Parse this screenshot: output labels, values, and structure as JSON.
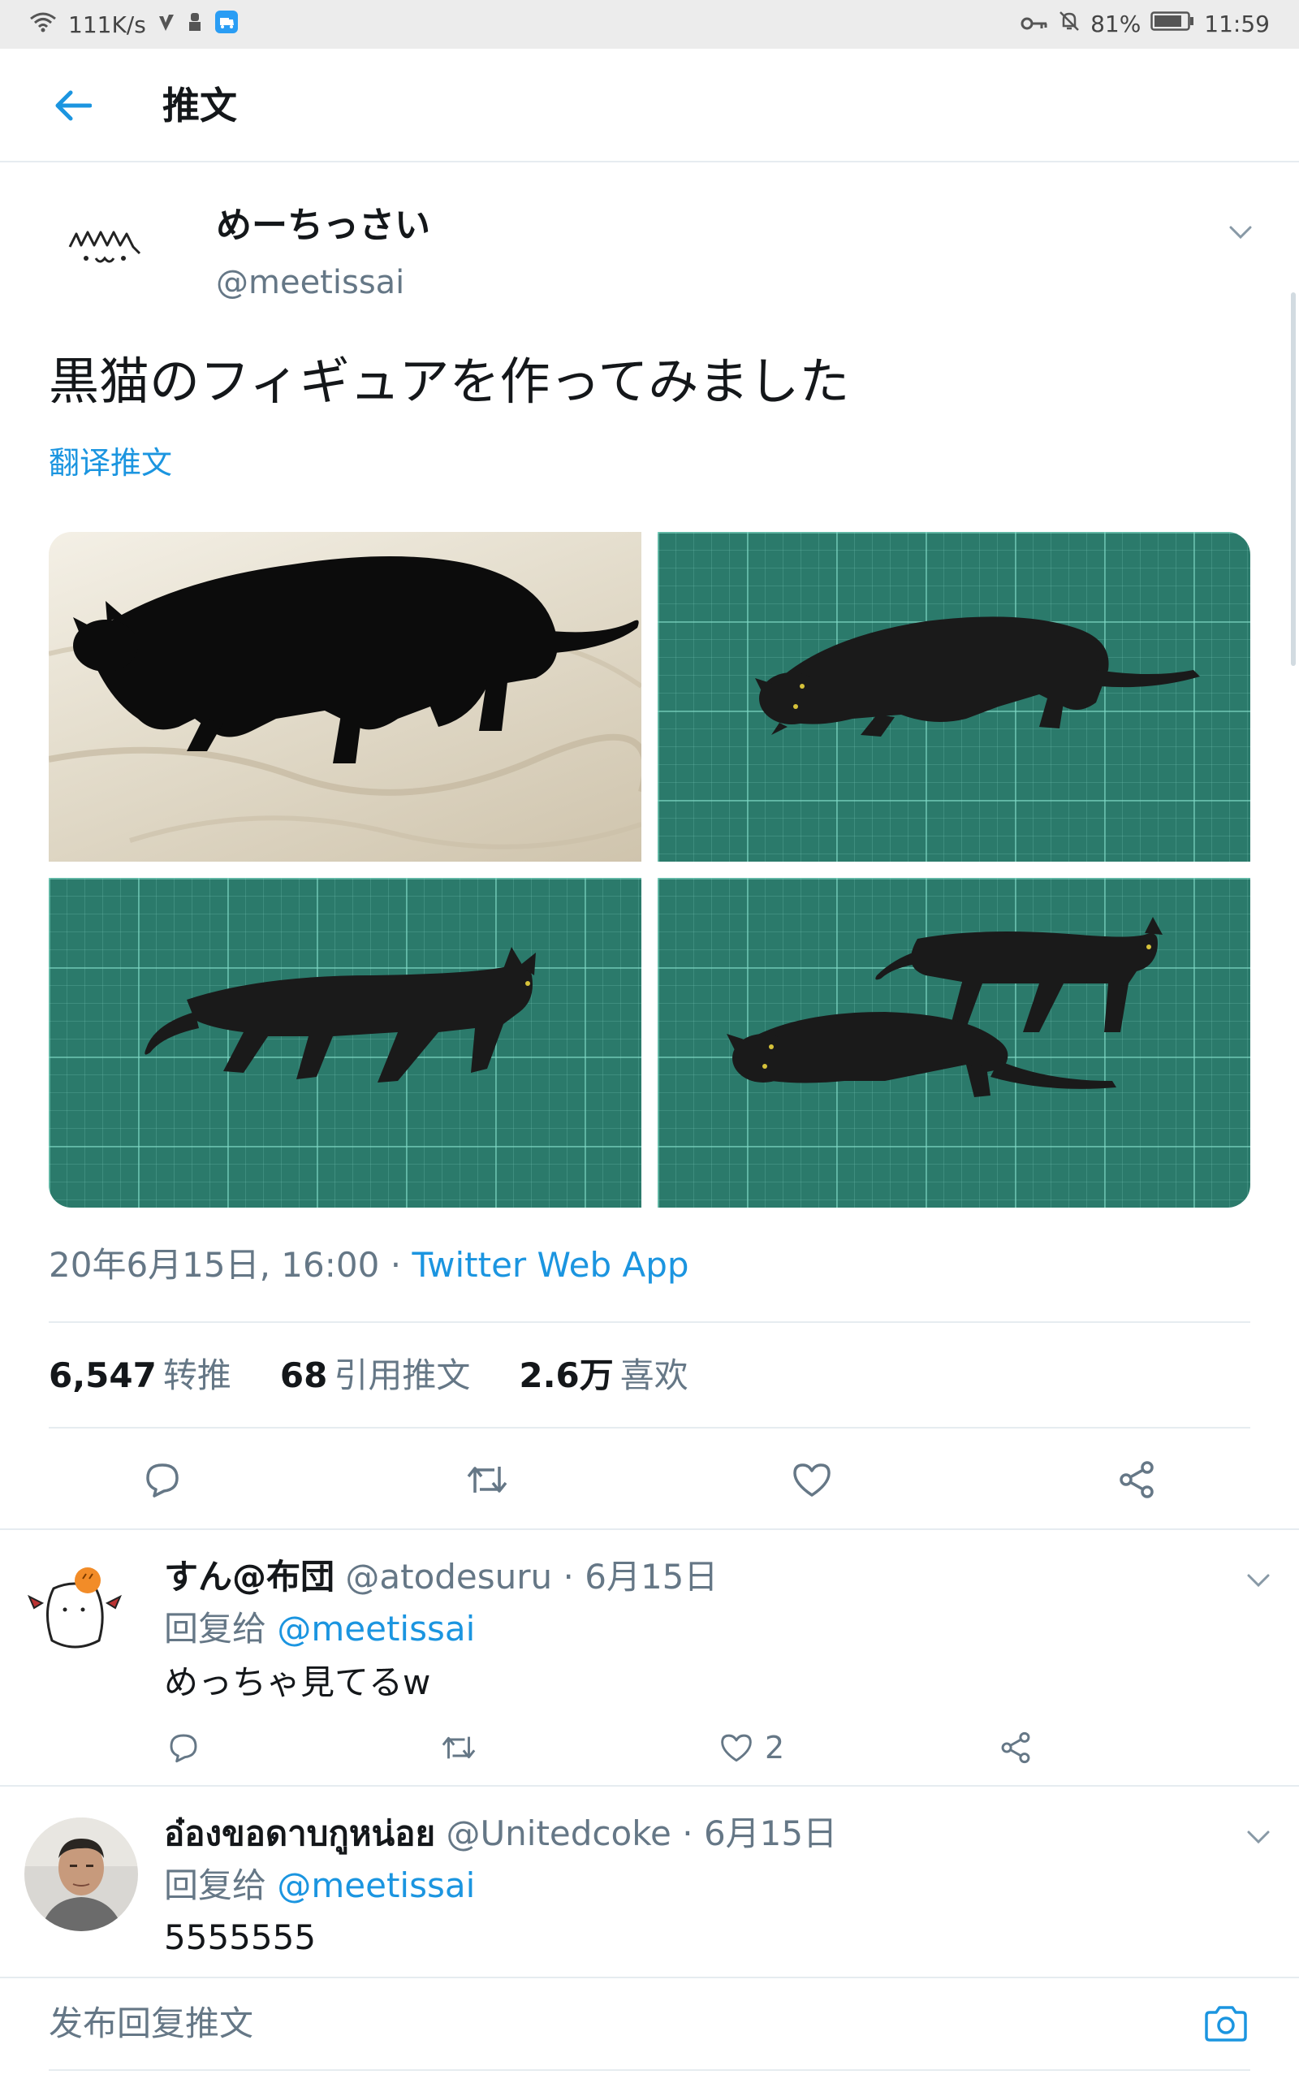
{
  "status_bar": {
    "net_speed": "111K/s",
    "battery": "81%",
    "time": "11:59"
  },
  "header": {
    "title": "推文"
  },
  "tweet": {
    "author_name": "めーちっさい",
    "author_handle": "@meetissai",
    "text": "黒猫のフィギュアを作ってみました",
    "translate_label": "翻译推文",
    "timestamp": "20年6月15日, 16:00",
    "separator": "·",
    "source": "Twitter Web App",
    "stats": [
      {
        "num": "6,547",
        "label": "转推"
      },
      {
        "num": "68",
        "label": "引用推文"
      },
      {
        "num": "2.6万",
        "label": "喜欢"
      }
    ]
  },
  "replies": [
    {
      "name": "すん@布団",
      "handle": "@atodesuru",
      "date": "· 6月15日",
      "reply_to_prefix": "回复给",
      "reply_to": "@meetissai",
      "text": "めっちゃ見てるw",
      "like_count": "2"
    },
    {
      "name": "อ๋องขอดาบกูหน่อย",
      "handle": "@Unitedcoke",
      "date": "· 6月15日",
      "reply_to_prefix": "回复给",
      "reply_to": "@meetissai",
      "text": "5555555"
    }
  ],
  "compose": {
    "placeholder": "发布回复推文"
  },
  "colors": {
    "accent": "#1b95e0",
    "secondary_text": "#657786",
    "divider": "#e6ecf0",
    "cutting_mat": "#2b7a6b"
  },
  "icons": [
    "wifi-icon",
    "signal-icon",
    "notification-icon",
    "vpn-key-icon",
    "mute-icon",
    "battery-icon",
    "back-arrow-icon",
    "chevron-down-icon",
    "reply-icon",
    "retweet-icon",
    "like-icon",
    "share-icon",
    "camera-icon"
  ]
}
